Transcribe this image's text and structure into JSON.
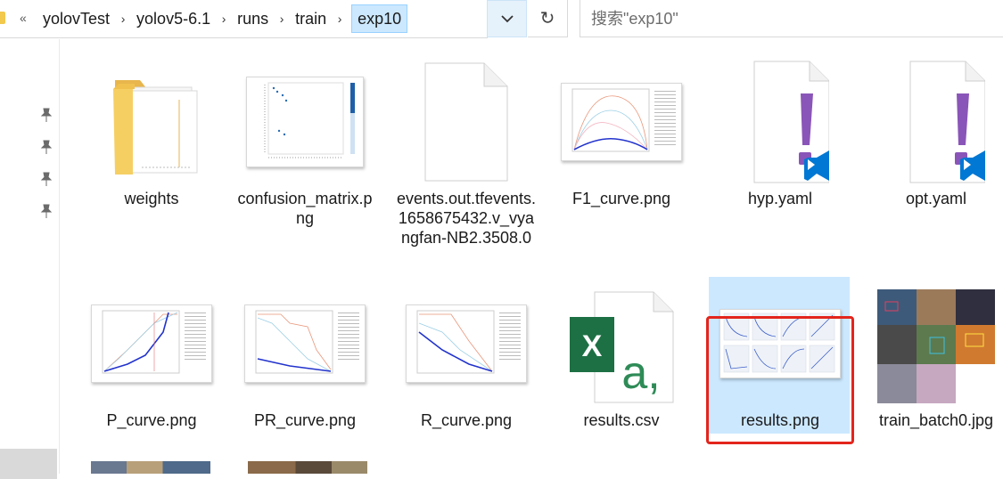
{
  "breadcrumb": {
    "overflow": "«",
    "items": [
      "yolovTest",
      "yolov5-6.1",
      "runs",
      "train",
      "exp10"
    ]
  },
  "search": {
    "placeholder": "搜索\"exp10\""
  },
  "files": [
    {
      "name": "weights",
      "type": "folder"
    },
    {
      "name": "confusion_matrix.png",
      "type": "png"
    },
    {
      "name": "events.out.tfevents.1658675432.v_vyangfan-NB2.3508.0",
      "type": "file"
    },
    {
      "name": "F1_curve.png",
      "type": "png"
    },
    {
      "name": "hyp.yaml",
      "type": "yaml"
    },
    {
      "name": "opt.yaml",
      "type": "yaml"
    },
    {
      "name": "P_curve.png",
      "type": "png"
    },
    {
      "name": "PR_curve.png",
      "type": "png"
    },
    {
      "name": "R_curve.png",
      "type": "png"
    },
    {
      "name": "results.csv",
      "type": "csv"
    },
    {
      "name": "results.png",
      "type": "png",
      "selected": true,
      "highlighted": true
    },
    {
      "name": "train_batch0.jpg",
      "type": "jpg"
    }
  ],
  "colors": {
    "accent": "#cce8ff",
    "highlight": "#e3251c",
    "excel": "#1d7044",
    "vscode": "#0078d4",
    "yaml_mark": "#8a55b8"
  }
}
